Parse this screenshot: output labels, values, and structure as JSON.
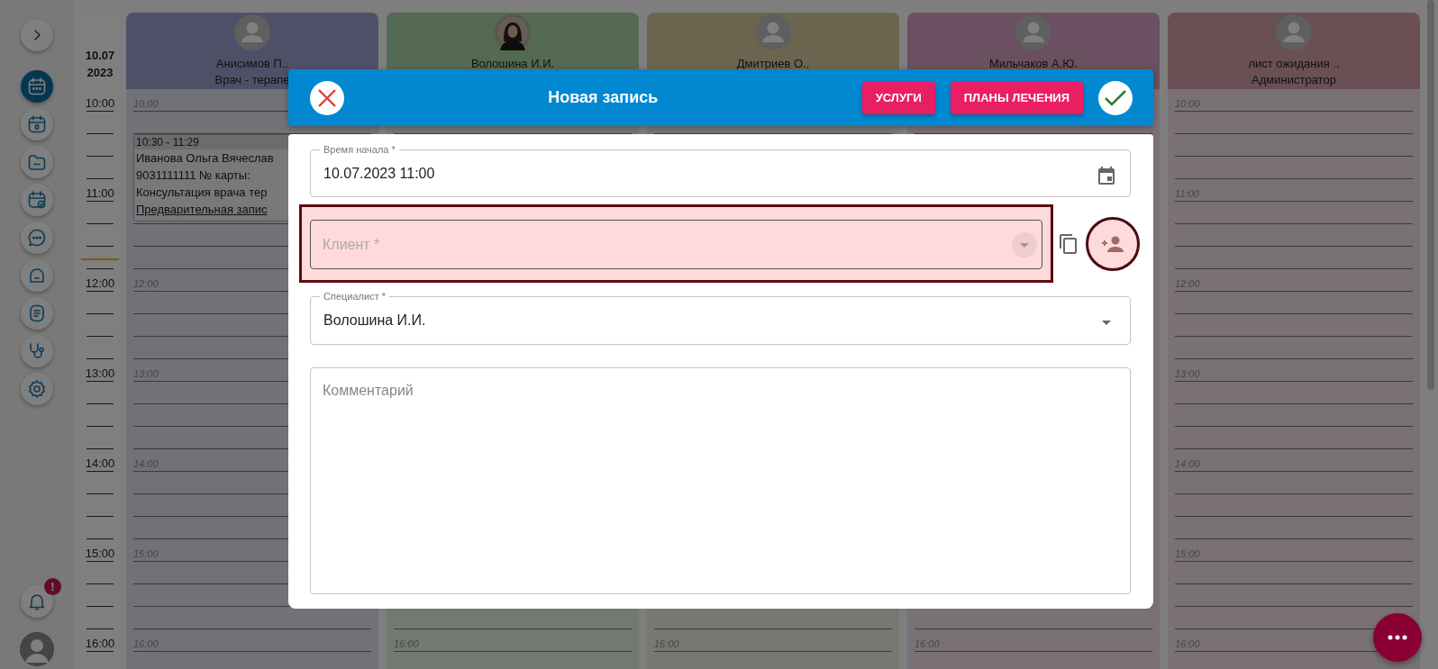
{
  "sidebar": {
    "items": [
      {
        "selected": true
      },
      {
        "selected": false
      },
      {
        "selected": false
      },
      {
        "selected": false
      },
      {
        "selected": false
      },
      {
        "selected": false
      },
      {
        "selected": false
      },
      {
        "selected": false
      },
      {
        "selected": false
      }
    ]
  },
  "notifications": {
    "badge": "!"
  },
  "time_axis": {
    "date": "10.07",
    "year": "2023",
    "hours": [
      "10:00",
      "11:00",
      "12:00",
      "13:00",
      "14:00",
      "15:00",
      "16:00"
    ]
  },
  "columns": [
    {
      "name": "Анисимов П..",
      "role": "Врач - терапе",
      "avatar": {
        "kind": "default"
      },
      "color": "#4f5068",
      "slots": [
        {
          "kind": "hour",
          "label": "10:00",
          "appointment": {
            "time": "10:30 - 11:29",
            "lines": [
              "Иванова Ольга Вячеслав",
              "9031111111  № карты:",
              "Консультация врача тер"
            ],
            "status": "Предварительная запис"
          }
        },
        {
          "kind": "covered"
        },
        {
          "kind": "hour",
          "label": "12:00"
        },
        {
          "kind": "hour",
          "label": "13:00"
        },
        {
          "kind": "hour",
          "label": "14:00"
        },
        {
          "kind": "hour",
          "label": "15:00"
        },
        {
          "kind": "hour",
          "label": "16:00"
        }
      ]
    },
    {
      "name": "Волошина И.И.",
      "color": "#546a52",
      "slots": [
        {
          "kind": "covered"
        },
        {
          "kind": "covered"
        },
        {
          "kind": "covered"
        },
        {
          "kind": "covered"
        },
        {
          "kind": "covered"
        },
        {
          "kind": "covered"
        },
        {
          "kind": "hour",
          "label": "16:00"
        }
      ]
    },
    {
      "name": "Дмитриев О..",
      "avatar": {
        "kind": "default"
      },
      "color": "#6b6550",
      "slots": [
        {
          "kind": "covered"
        },
        {
          "kind": "covered"
        },
        {
          "kind": "covered"
        },
        {
          "kind": "covered"
        },
        {
          "kind": "covered"
        },
        {
          "kind": "covered"
        },
        {
          "kind": "hour",
          "label": "16:00"
        }
      ]
    },
    {
      "name": "Мильчаков А.Ю.",
      "avatar": {
        "kind": "default"
      },
      "color": "#6a5060",
      "slots": [
        {
          "kind": "covered"
        },
        {
          "kind": "covered"
        },
        {
          "kind": "covered"
        },
        {
          "kind": "covered"
        },
        {
          "kind": "covered"
        },
        {
          "kind": "covered"
        },
        {
          "kind": "hour",
          "label": "16:00"
        }
      ]
    },
    {
      "name": "лист ожидания ..",
      "role": "Администратор",
      "avatar": {
        "kind": "default"
      },
      "color": "#6a4f55",
      "slots": [
        {
          "kind": "hour",
          "label": "10:00"
        },
        {
          "kind": "hour",
          "label": "11:00"
        },
        {
          "kind": "hour",
          "label": "12:00"
        },
        {
          "kind": "hour",
          "label": "13:00"
        },
        {
          "kind": "hour",
          "label": "14:00"
        },
        {
          "kind": "hour",
          "label": "15:00"
        },
        {
          "kind": "hour",
          "label": "16:00"
        }
      ]
    }
  ],
  "dialog": {
    "title": "Новая запись",
    "buttons": [
      "УСЛУГИ",
      "ПЛАНЫ ЛЕЧЕНИЯ"
    ],
    "fields": [
      {
        "kind": "datetime",
        "label": "Время начала *",
        "value": "10.07.2023 11:00"
      },
      {
        "kind": "combobox",
        "placeholder": "Клиент *",
        "highlighted": true
      },
      {
        "kind": "select",
        "label": "Специалист *",
        "value": "Волошина И.И."
      },
      {
        "kind": "textarea",
        "placeholder": "Комментарий"
      }
    ]
  }
}
